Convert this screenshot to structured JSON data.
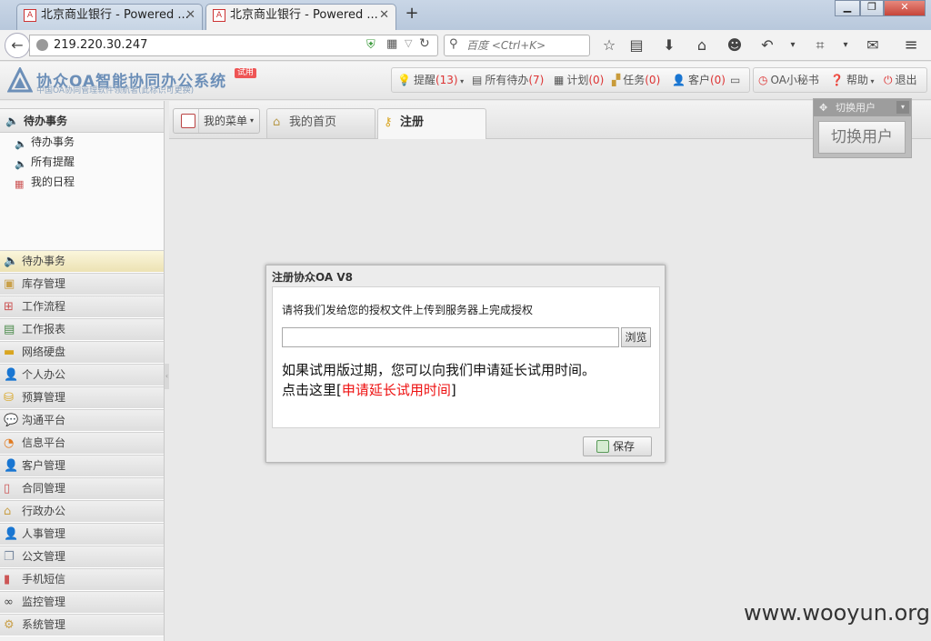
{
  "browser": {
    "tabs": [
      {
        "title": "北京商业银行 - Powered ...",
        "active": false
      },
      {
        "title": "北京商业银行 - Powered ...",
        "active": true
      }
    ],
    "url": "219.220.30.247",
    "search_placeholder": "百度 <Ctrl+K>",
    "new_tab": "+",
    "close": "✕"
  },
  "app": {
    "title": "协众OA智能协同办公系统",
    "subtitle": "中国OA协同管理软件领航者(此标识可更换)",
    "badge": "试用",
    "toolbar": {
      "remind": "提醒",
      "remind_count": "(13)",
      "pending": "所有待办",
      "pending_count": "(7)",
      "plan": "计划",
      "plan_count": "(0)",
      "task": "任务",
      "task_count": "(0)",
      "customer": "客户",
      "customer_count": "(0)",
      "secretary": "OA小秘书",
      "help": "帮助",
      "logout": "退出"
    }
  },
  "switch_user": {
    "header": "切换用户",
    "button": "切换用户"
  },
  "sidebar": {
    "todo_header": "待办事务",
    "todo_items": [
      "待办事务",
      "所有提醒",
      "我的日程"
    ],
    "menu": [
      "待办事务",
      "库存管理",
      "工作流程",
      "工作报表",
      "网络硬盘",
      "个人办公",
      "预算管理",
      "沟通平台",
      "信息平台",
      "客户管理",
      "合同管理",
      "行政办公",
      "人事管理",
      "公文管理",
      "手机短信",
      "监控管理",
      "系统管理"
    ]
  },
  "content": {
    "menu_button": "我的菜单",
    "tabs": [
      "我的首页",
      "注册"
    ]
  },
  "dialog": {
    "title": "注册协众OA V8",
    "message": "请将我们发给您的授权文件上传到服务器上完成授权",
    "browse": "浏览",
    "expire_line1": "如果试用版过期，您可以向我们申请延长试用时间。",
    "expire_prefix": "点击这里[",
    "expire_link": "申请延长试用时间",
    "expire_suffix": "]",
    "save": "保存"
  },
  "watermark": "www.wooyun.org"
}
